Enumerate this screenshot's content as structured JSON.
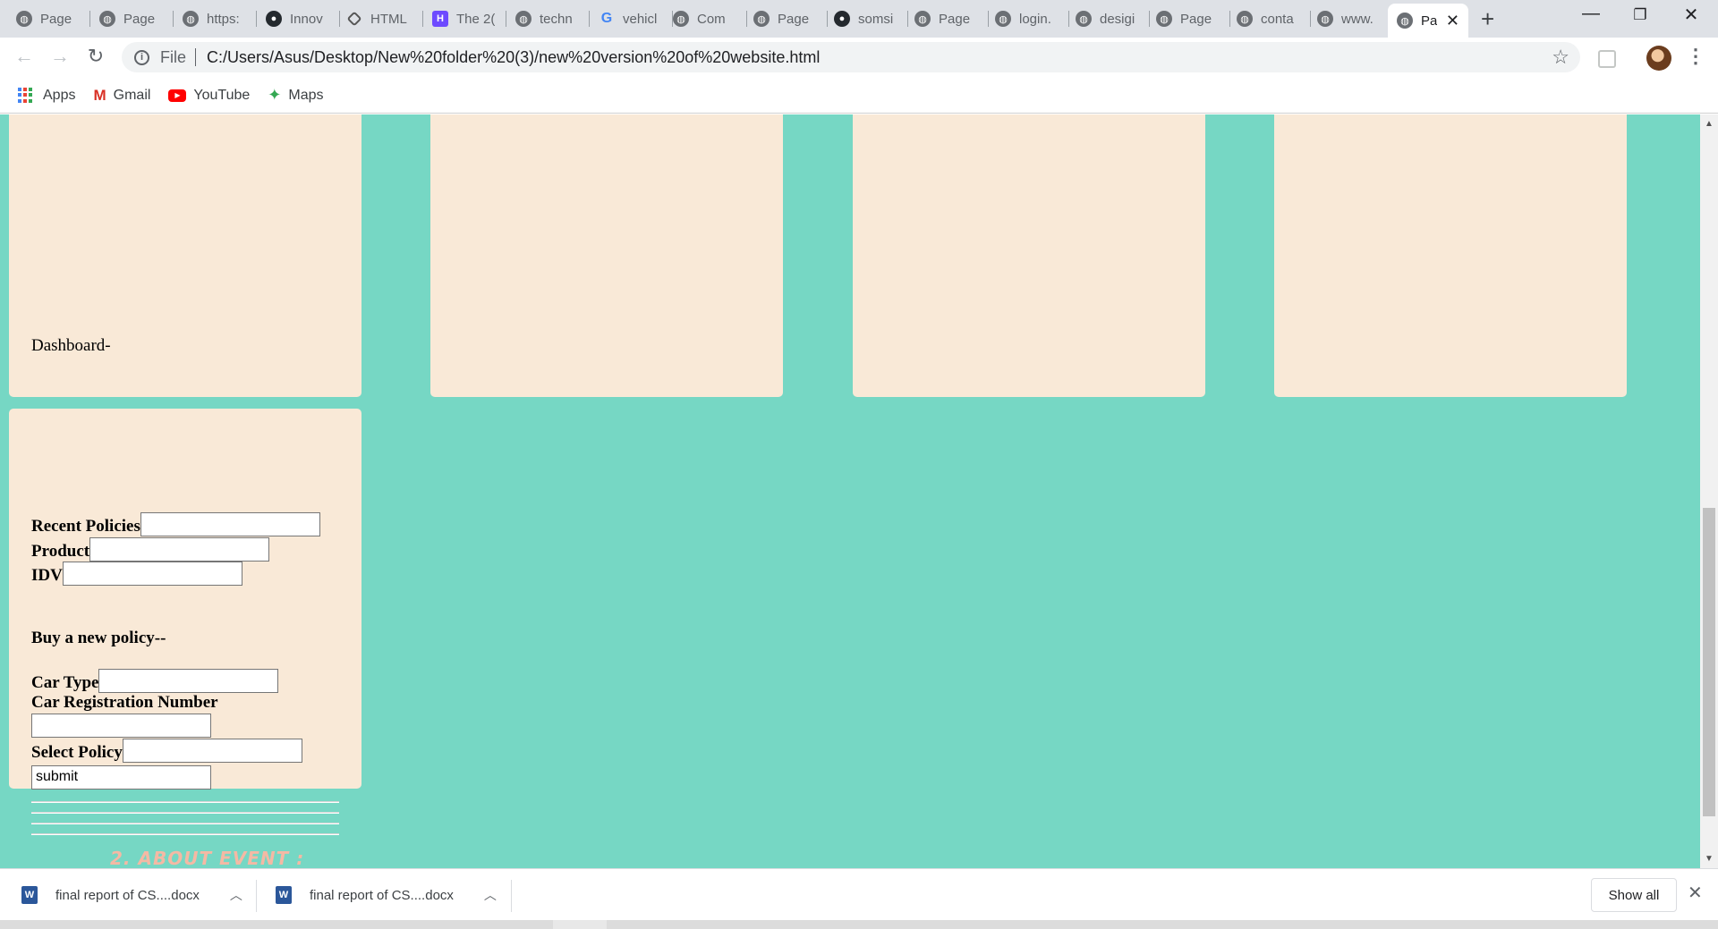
{
  "browser": {
    "tabs": [
      {
        "label": "Page",
        "icon": "globe-icon"
      },
      {
        "label": "Page",
        "icon": "globe-icon"
      },
      {
        "label": "https:",
        "icon": "globe-icon"
      },
      {
        "label": "Innov",
        "icon": "github-icon"
      },
      {
        "label": "HTML",
        "icon": "code-icon"
      },
      {
        "label": "The 2(",
        "icon": "h-logo-icon"
      },
      {
        "label": "techn",
        "icon": "globe-icon"
      },
      {
        "label": "vehicl",
        "icon": "google-icon"
      },
      {
        "label": "Com",
        "icon": "globe-icon"
      },
      {
        "label": "Page",
        "icon": "globe-icon"
      },
      {
        "label": "somsi",
        "icon": "github-icon"
      },
      {
        "label": "Page",
        "icon": "globe-icon"
      },
      {
        "label": "login.",
        "icon": "globe-icon"
      },
      {
        "label": "desigi",
        "icon": "globe-icon"
      },
      {
        "label": "Page",
        "icon": "globe-icon"
      },
      {
        "label": "conta",
        "icon": "globe-icon"
      },
      {
        "label": "www.",
        "icon": "globe-icon"
      }
    ],
    "active_tab": {
      "label": "Pa",
      "icon": "globe-icon"
    },
    "new_tab": "+",
    "address": {
      "scheme_label": "File",
      "url": "C:/Users/Asus/Desktop/New%20folder%20(3)/new%20version%20of%20website.html"
    },
    "bookmarks": [
      {
        "label": "Apps",
        "icon": "apps-grid-icon"
      },
      {
        "label": "Gmail",
        "icon": "gmail-icon"
      },
      {
        "label": "YouTube",
        "icon": "youtube-icon"
      },
      {
        "label": "Maps",
        "icon": "maps-icon"
      }
    ]
  },
  "page": {
    "background": "#76d7c4",
    "card_color": "#f9e9d7",
    "dashboard": {
      "title": "Dashboard-",
      "recent_policies_label": "Recent Policies",
      "product_label": "Product",
      "idv_label": "IDV",
      "buy_title": "Buy a new policy--",
      "car_type_label": "Car Type",
      "car_reg_label": "Car Registration Number",
      "select_policy_label": "Select Policy",
      "submit_value": "submit"
    },
    "about_heading": "2. ABOUT EVENT :"
  },
  "downloads": {
    "items": [
      {
        "filename": "final report of CS....docx",
        "icon": "word-doc-icon"
      },
      {
        "filename": "final report of CS....docx",
        "icon": "word-doc-icon"
      }
    ],
    "show_all": "Show all"
  }
}
